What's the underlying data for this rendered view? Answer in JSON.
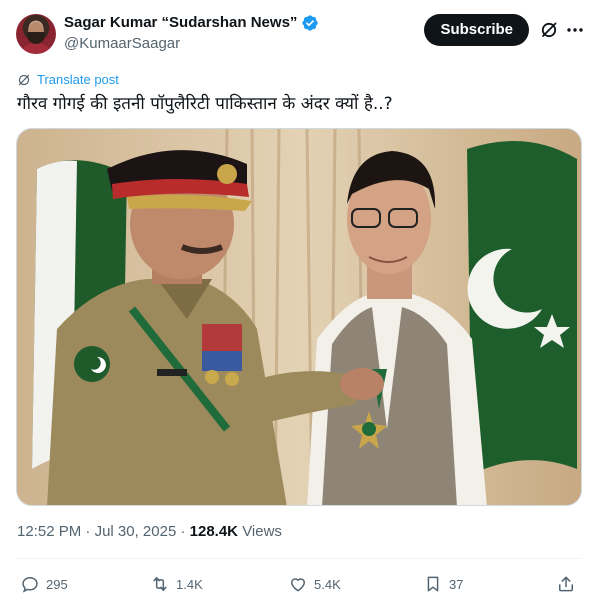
{
  "author": {
    "display_name": "Sagar Kumar “Sudarshan News”",
    "handle": "@KumaarSaagar",
    "verified": true
  },
  "header": {
    "subscribe_label": "Subscribe"
  },
  "translate_label": "Translate post",
  "tweet_text": "गौरव गोगई की इतनी पॉपुलैरिटी पाकिस्तान के अंदर क्यों है..?",
  "meta": {
    "time": "12:52 PM",
    "date": "Jul 30, 2025",
    "views": "128.4K",
    "views_label": "Views"
  },
  "actions": {
    "replies": "295",
    "reposts": "1.4K",
    "likes": "5.4K",
    "bookmarks": "37"
  },
  "colors": {
    "accent": "#1d9bf0",
    "verified": "#1d9bf0",
    "text": "#0f1419",
    "muted": "#536471"
  },
  "icons": [
    "verified-badge-icon",
    "grok-icon",
    "more-icon",
    "translate-icon",
    "reply-icon",
    "repost-icon",
    "like-icon",
    "bookmark-icon",
    "share-icon"
  ]
}
